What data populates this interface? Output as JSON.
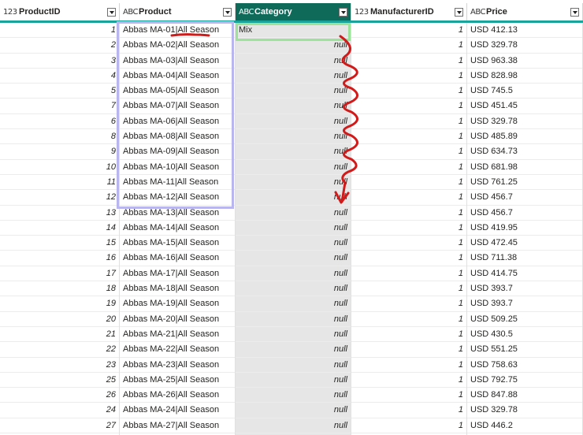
{
  "columns": [
    {
      "name": "ProductID",
      "type_icon": "123"
    },
    {
      "name": "Product",
      "type_icon": "ABC"
    },
    {
      "name": "Category",
      "type_icon": "ABC"
    },
    {
      "name": "ManufacturerID",
      "type_icon": "123"
    },
    {
      "name": "Price",
      "type_icon": "ABC"
    }
  ],
  "null_text": "null",
  "rows": [
    {
      "id": "1",
      "product": "Abbas MA-01|All Season",
      "category": "Mix",
      "mfr": "1",
      "price": "USD 412.13"
    },
    {
      "id": "2",
      "product": "Abbas MA-02|All Season",
      "category": "null",
      "mfr": "1",
      "price": "USD 329.78"
    },
    {
      "id": "3",
      "product": "Abbas MA-03|All Season",
      "category": "null",
      "mfr": "1",
      "price": "USD 963.38"
    },
    {
      "id": "4",
      "product": "Abbas MA-04|All Season",
      "category": "null",
      "mfr": "1",
      "price": "USD 828.98"
    },
    {
      "id": "5",
      "product": "Abbas MA-05|All Season",
      "category": "null",
      "mfr": "1",
      "price": "USD 745.5"
    },
    {
      "id": "7",
      "product": "Abbas MA-07|All Season",
      "category": "null",
      "mfr": "1",
      "price": "USD 451.45"
    },
    {
      "id": "6",
      "product": "Abbas MA-06|All Season",
      "category": "null",
      "mfr": "1",
      "price": "USD 329.78"
    },
    {
      "id": "8",
      "product": "Abbas MA-08|All Season",
      "category": "null",
      "mfr": "1",
      "price": "USD 485.89"
    },
    {
      "id": "9",
      "product": "Abbas MA-09|All Season",
      "category": "null",
      "mfr": "1",
      "price": "USD 634.73"
    },
    {
      "id": "10",
      "product": "Abbas MA-10|All Season",
      "category": "null",
      "mfr": "1",
      "price": "USD 681.98"
    },
    {
      "id": "11",
      "product": "Abbas MA-11|All Season",
      "category": "null",
      "mfr": "1",
      "price": "USD 761.25"
    },
    {
      "id": "12",
      "product": "Abbas MA-12|All Season",
      "category": "null",
      "mfr": "1",
      "price": "USD 456.7"
    },
    {
      "id": "13",
      "product": "Abbas MA-13|All Season",
      "category": "null",
      "mfr": "1",
      "price": "USD 456.7"
    },
    {
      "id": "14",
      "product": "Abbas MA-14|All Season",
      "category": "null",
      "mfr": "1",
      "price": "USD 419.95"
    },
    {
      "id": "15",
      "product": "Abbas MA-15|All Season",
      "category": "null",
      "mfr": "1",
      "price": "USD 472.45"
    },
    {
      "id": "16",
      "product": "Abbas MA-16|All Season",
      "category": "null",
      "mfr": "1",
      "price": "USD 711.38"
    },
    {
      "id": "17",
      "product": "Abbas MA-17|All Season",
      "category": "null",
      "mfr": "1",
      "price": "USD 414.75"
    },
    {
      "id": "18",
      "product": "Abbas MA-18|All Season",
      "category": "null",
      "mfr": "1",
      "price": "USD 393.7"
    },
    {
      "id": "19",
      "product": "Abbas MA-19|All Season",
      "category": "null",
      "mfr": "1",
      "price": "USD 393.7"
    },
    {
      "id": "20",
      "product": "Abbas MA-20|All Season",
      "category": "null",
      "mfr": "1",
      "price": "USD 509.25"
    },
    {
      "id": "21",
      "product": "Abbas MA-21|All Season",
      "category": "null",
      "mfr": "1",
      "price": "USD 430.5"
    },
    {
      "id": "22",
      "product": "Abbas MA-22|All Season",
      "category": "null",
      "mfr": "1",
      "price": "USD 551.25"
    },
    {
      "id": "23",
      "product": "Abbas MA-23|All Season",
      "category": "null",
      "mfr": "1",
      "price": "USD 758.63"
    },
    {
      "id": "25",
      "product": "Abbas MA-25|All Season",
      "category": "null",
      "mfr": "1",
      "price": "USD 792.75"
    },
    {
      "id": "26",
      "product": "Abbas MA-26|All Season",
      "category": "null",
      "mfr": "1",
      "price": "USD 847.88"
    },
    {
      "id": "24",
      "product": "Abbas MA-24|All Season",
      "category": "null",
      "mfr": "1",
      "price": "USD 329.78"
    },
    {
      "id": "27",
      "product": "Abbas MA-27|All Season",
      "category": "null",
      "mfr": "1",
      "price": "USD 446.2"
    }
  ],
  "colors": {
    "selected_header": "#0f6a5a",
    "teal_line": "#1aa39b",
    "category_column_bg": "#e6e6e6",
    "annotation_red": "#d11a1a",
    "product_selection": "#b9b5ee",
    "category_selection": "#9be29b"
  }
}
